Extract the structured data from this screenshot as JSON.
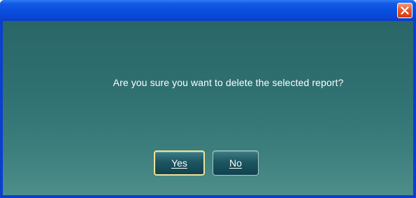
{
  "dialog": {
    "message": "Are you sure you want to delete the selected report?",
    "close_icon": "close-x-icon"
  },
  "buttons": {
    "yes_label": "Yes",
    "no_label": "No"
  },
  "colors": {
    "titlebar": "#0a4fde",
    "close_button": "#e2582d",
    "client_background": "#2f7071",
    "default_button_border": "#f0e29a"
  }
}
